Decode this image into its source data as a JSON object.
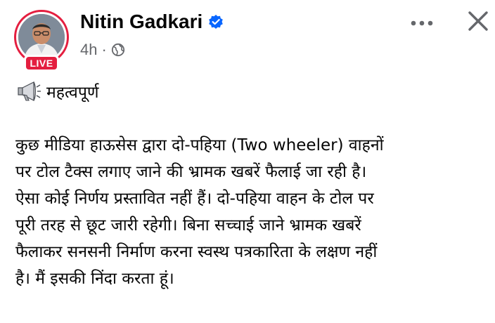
{
  "post": {
    "author": "Nitin Gadkari",
    "live_badge": "LIVE",
    "timestamp": "4h",
    "separator": "·",
    "audience_icon": "globe-icon",
    "verified_icon": "verified-badge-icon",
    "headline_icon": "megaphone-icon",
    "headline": "महत्वपूर्ण",
    "body_lines": [
      "कुछ मीडिया हाऊसेस  द्वारा दो-पहिया (Two wheeler) वाहनों",
      "पर टोल टैक्स लगाए जाने की भ्रामक खबरें फैलाई जा रही है।",
      "ऐसा कोई निर्णय प्रस्तावित नहीं हैं। दो-पहिया वाहन के टोल पर",
      "पूरी तरह से छूट जारी रहेगी। बिना सच्चाई जाने भ्रामक खबरें",
      "फैलाकर सनसनी निर्माण करना स्वस्थ पत्रकारिता के लक्षण नहीं",
      "है। मैं इसकी निंदा करता हूं।"
    ]
  },
  "actions": {
    "more_icon": "more-options-icon",
    "close_icon": "close-icon"
  },
  "colors": {
    "live_red": "#e41e3f",
    "verified_blue": "#0866ff",
    "meta_gray": "#65676b",
    "text": "#050505"
  }
}
